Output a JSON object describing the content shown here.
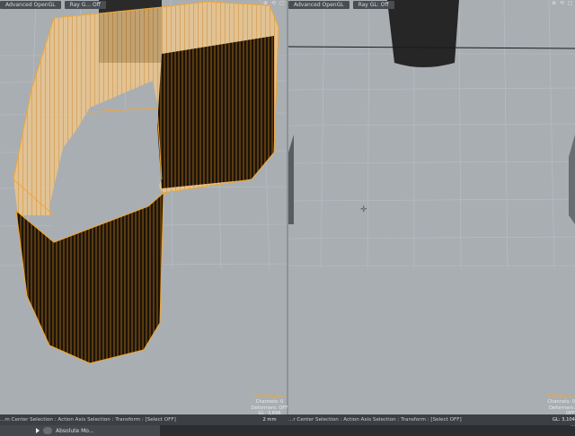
{
  "app": {
    "name": "modo-like 3D editor"
  },
  "viewport_left": {
    "header_buttons": [
      "Advanced OpenGL",
      "Ray G... Off"
    ],
    "info": {
      "selection": "176 Polygons",
      "channels": "Channels: 0",
      "deformers": "Deformers: OFF",
      "gl": "GL: 3,896",
      "size": "2 mm"
    }
  },
  "viewport_right": {
    "header_buttons": [
      "Advanced OpenGL",
      "Ray GL: Off"
    ],
    "info": {
      "selection": "All Polygons",
      "channels": "Channels: 0",
      "deformers": "Deformers: OFF",
      "gl": "GL: 3,104",
      "size": "..."
    }
  },
  "statusbar": {
    "left_text": "...m Center Selection : Action Axis Selection : Transform : [Select OFF]",
    "right_text": "...r Center Selection : Action Axis Selection : Transform : [Select OFF]"
  },
  "bottombar": {
    "tab_label": "Absolute Mo..."
  },
  "colors": {
    "selection": "#f0a733",
    "background": "#a9aeb3",
    "mesh_dark": "#2a2a2a"
  }
}
